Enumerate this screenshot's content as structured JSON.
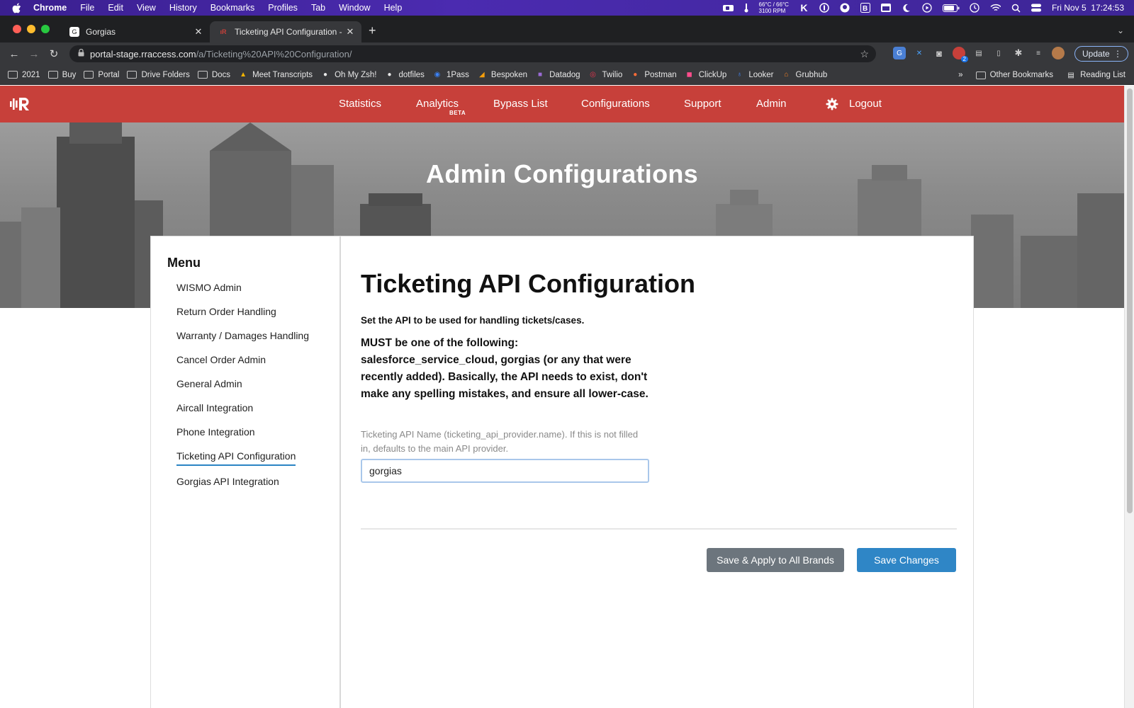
{
  "os_menubar": {
    "app": "Chrome",
    "items": [
      "File",
      "Edit",
      "View",
      "History",
      "Bookmarks",
      "Profiles",
      "Tab",
      "Window",
      "Help"
    ],
    "temp_line1": "66°C / 66°C",
    "temp_line2": "3100 RPM",
    "datetime": "Fri Nov 5  17:24:53"
  },
  "browser": {
    "tabs": [
      {
        "title": "Gorgias",
        "active": false
      },
      {
        "title": "Ticketing API Configuration - R",
        "active": true
      }
    ],
    "url_host": "portal-stage.rraccess.com",
    "url_path": "/a/Ticketing%20API%20Configuration/",
    "update_label": "Update",
    "ext_badge": "2",
    "bookmarks": [
      "2021",
      "Buy",
      "Portal",
      "Drive Folders",
      "Docs",
      "Meet Transcripts",
      "Oh My Zsh!",
      "dotfiles",
      "1Pass",
      "Bespoken",
      "Datadog",
      "Twilio",
      "Postman",
      "ClickUp",
      "Looker",
      "Grubhub"
    ],
    "bookmarks_overflow": "»",
    "other_bookmarks": "Other Bookmarks",
    "reading_list": "Reading List"
  },
  "site_nav": {
    "links": [
      "Statistics",
      "Analytics",
      "Bypass List",
      "Configurations",
      "Support",
      "Admin",
      "Logout"
    ],
    "beta_badge": "BETA"
  },
  "hero": {
    "title": "Admin Configurations"
  },
  "sidebar": {
    "title": "Menu",
    "items": [
      {
        "label": "WISMO Admin"
      },
      {
        "label": "Return Order Handling"
      },
      {
        "label": "Warranty / Damages Handling"
      },
      {
        "label": "Cancel Order Admin"
      },
      {
        "label": "General Admin"
      },
      {
        "label": "Aircall Integration"
      },
      {
        "label": "Phone Integration"
      },
      {
        "label": "Ticketing API Configuration",
        "active": true
      },
      {
        "label": "Gorgias API Integration"
      }
    ]
  },
  "main": {
    "heading": "Ticketing API Configuration",
    "description": "Set the API to be used for handling tickets/cases.",
    "requirement": "MUST be one of the following: salesforce_service_cloud, gorgias (or any that were recently added). Basically, the API needs to exist, don't make any spelling mistakes, and ensure all lower-case.",
    "field_help": "Ticketing API Name (ticketing_api_provider.name). If this is not filled in, defaults to the main API provider.",
    "field_value": "gorgias",
    "apply_all_label": "Save & Apply to All Brands",
    "save_label": "Save Changes"
  },
  "colors": {
    "nav_red": "#c7403a",
    "primary_blue": "#2f86c6",
    "secondary_gray": "#6c757d",
    "active_underline": "#2a84c4"
  }
}
